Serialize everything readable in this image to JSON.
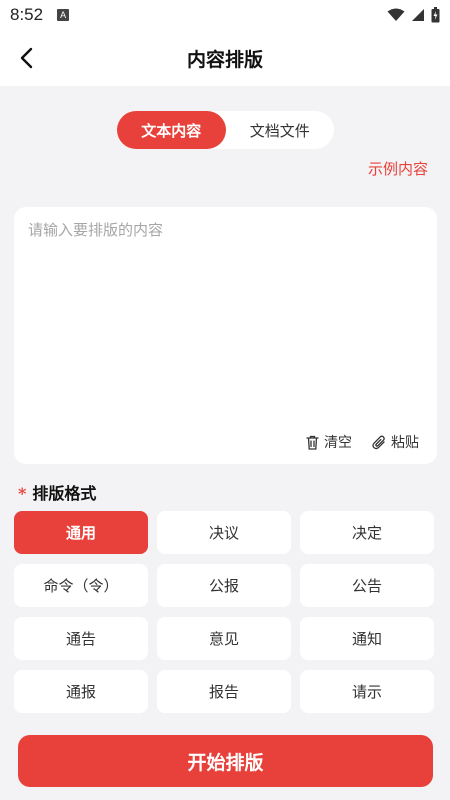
{
  "status_bar": {
    "time": "8:52",
    "notification_icon": "A"
  },
  "header": {
    "title": "内容排版",
    "back_icon": "chevron-left-icon"
  },
  "tabs": [
    {
      "label": "文本内容",
      "active": true
    },
    {
      "label": "文档文件",
      "active": false
    }
  ],
  "example_link": "示例内容",
  "editor": {
    "placeholder": "请输入要排版的内容",
    "value": "",
    "clear_label": "清空",
    "paste_label": "粘贴"
  },
  "format": {
    "required_mark": "*",
    "title": "排版格式",
    "options": [
      "通用",
      "决议",
      "决定",
      "命令（令）",
      "公报",
      "公告",
      "通告",
      "意见",
      "通知",
      "通报",
      "报告",
      "请示"
    ],
    "selected_index": 0
  },
  "start_button": "开始排版",
  "colors": {
    "accent": "#e8403a",
    "background": "#f3f3f5"
  }
}
